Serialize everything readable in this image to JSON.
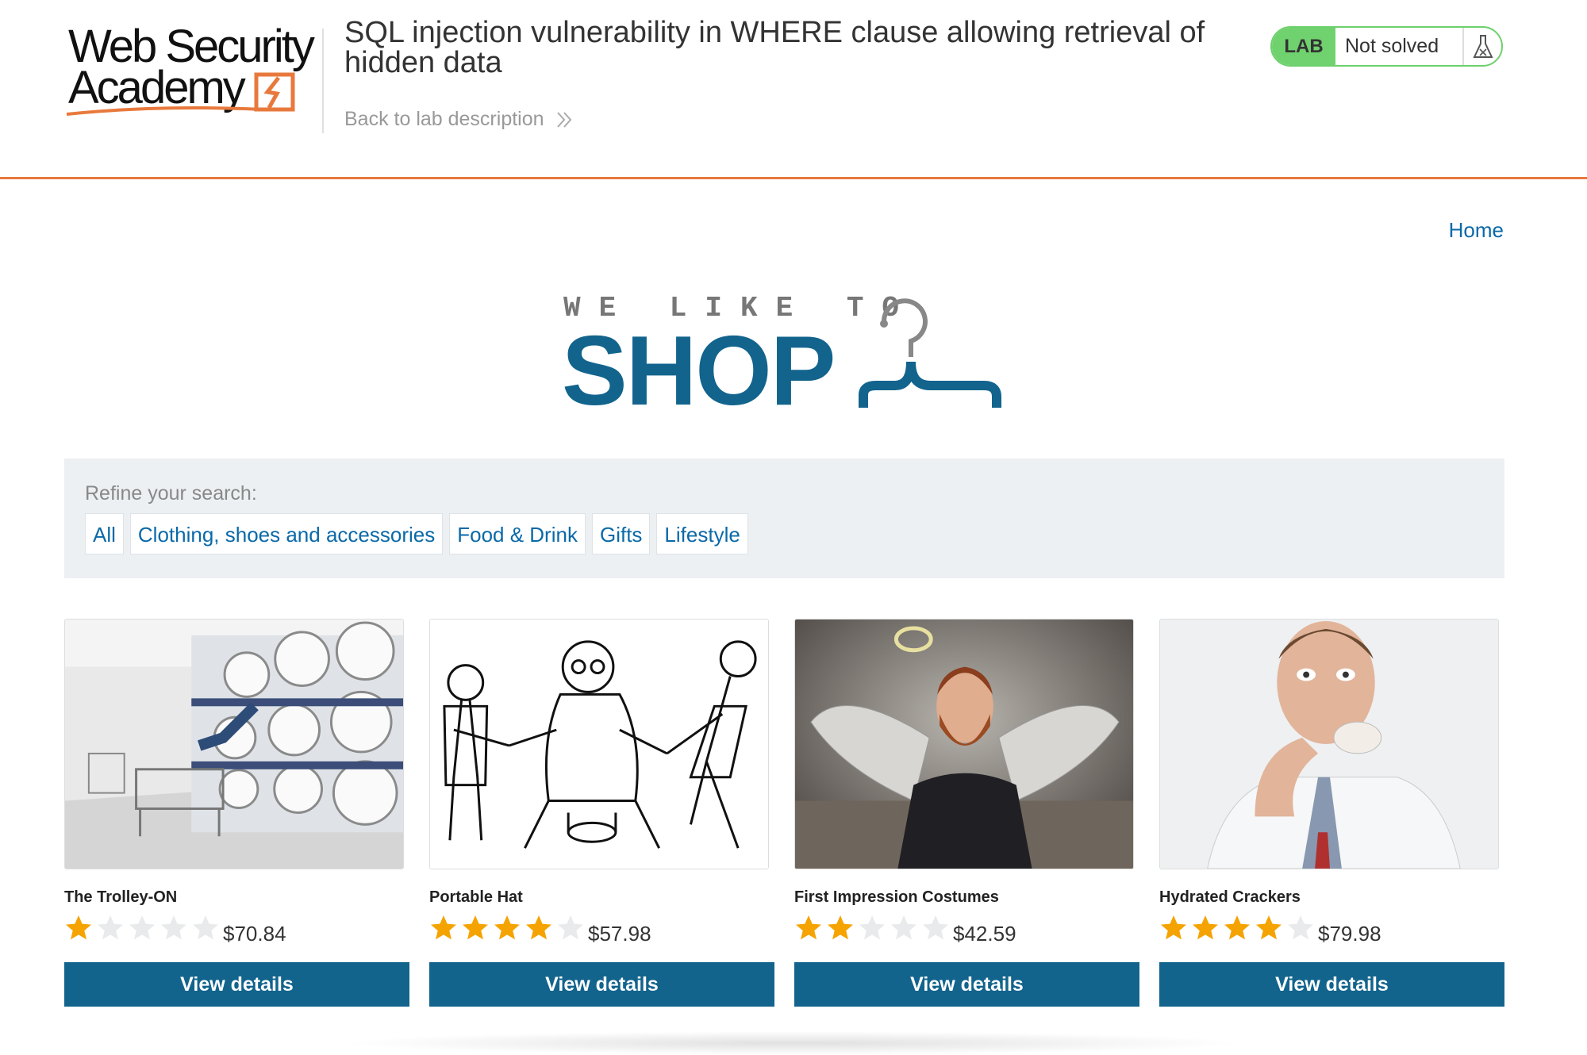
{
  "academy": {
    "logo_line1": "Web Security",
    "logo_line2": "Academy",
    "lab_title": "SQL injection vulnerability in WHERE clause allowing retrieval of hidden data",
    "back_link": "Back to lab description",
    "lab_badge": "LAB",
    "lab_status": "Not solved",
    "accent_color": "#e8793c"
  },
  "shop": {
    "home_link": "Home",
    "tagline": "WE LIKE TO",
    "word": "SHOP",
    "brand_color": "#12648d",
    "hanger_icon": "hanger-icon"
  },
  "filter": {
    "label": "Refine your search:",
    "categories": [
      "All",
      "Clothing, shoes and accessories",
      "Food & Drink",
      "Gifts",
      "Lifestyle"
    ]
  },
  "products": [
    {
      "name": "The Trolley-ON",
      "rating": 1,
      "rating_max": 5,
      "price": "$70.84",
      "button": "View details",
      "image": "laundromat-photo"
    },
    {
      "name": "Portable Hat",
      "rating": 4,
      "rating_max": 5,
      "price": "$57.98",
      "button": "View details",
      "image": "cartoon-sketch"
    },
    {
      "name": "First Impression Costumes",
      "rating": 2,
      "rating_max": 5,
      "price": "$42.59",
      "button": "View details",
      "image": "angel-man-photo"
    },
    {
      "name": "Hydrated Crackers",
      "rating": 4,
      "rating_max": 5,
      "price": "$79.98",
      "button": "View details",
      "image": "man-eating-photo"
    }
  ]
}
